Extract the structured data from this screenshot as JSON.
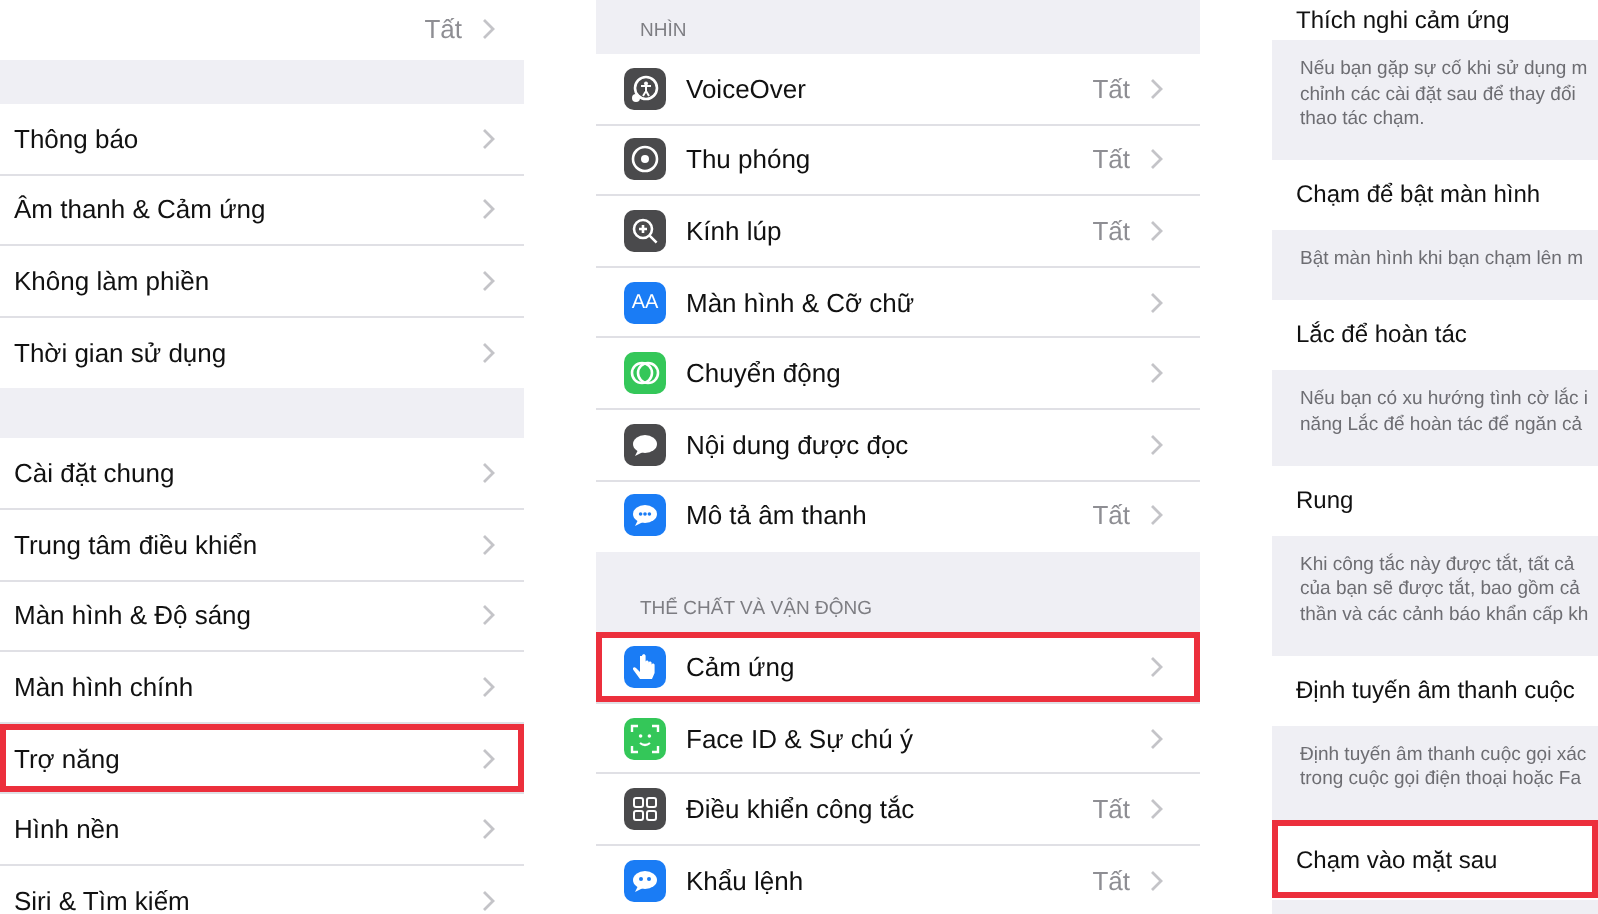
{
  "settings_list": {
    "groups": [
      [
        {
          "value": "Tất",
          "highlighted": false
        }
      ],
      [
        {
          "label": "Thông báo",
          "highlighted": false
        },
        {
          "label": "Âm thanh & Cảm ứng",
          "highlighted": false
        },
        {
          "label": "Không làm phiền",
          "highlighted": false
        },
        {
          "label": "Thời gian sử dụng",
          "highlighted": false
        }
      ],
      [
        {
          "label": "Cài đặt chung",
          "highlighted": false
        },
        {
          "label": "Trung tâm điều khiển",
          "highlighted": false
        },
        {
          "label": "Màn hình & Độ sáng",
          "highlighted": false
        },
        {
          "label": "Màn hình chính",
          "highlighted": false
        },
        {
          "label": "Trợ năng",
          "highlighted": true
        },
        {
          "label": "Hình nền",
          "highlighted": false
        },
        {
          "label": "Siri & Tìm kiếm",
          "highlighted": false
        }
      ]
    ]
  },
  "accessibility_list": {
    "sections": [
      {
        "header": "NHÌN",
        "rows": [
          {
            "label": "VoiceOver",
            "value": "Tất",
            "color": "#4a4a4c",
            "highlighted": false
          },
          {
            "label": "Thu phóng",
            "value": "Tất",
            "color": "#4a4a4c",
            "highlighted": false
          },
          {
            "label": "Kính lúp",
            "value": "Tất",
            "color": "#4a4a4c",
            "highlighted": false
          },
          {
            "label": "Màn hình & Cỡ chữ",
            "icon_text": "AA",
            "color": "#1a7cf5",
            "highlighted": false
          },
          {
            "label": "Chuyển động",
            "color": "#34c759",
            "highlighted": false
          },
          {
            "label": "Nội dung được đọc",
            "color": "#4a4a4c",
            "highlighted": false
          },
          {
            "label": "Mô tả âm thanh",
            "value": "Tất",
            "color": "#1a7cf5",
            "highlighted": false
          }
        ]
      },
      {
        "header": "THỂ CHẤT VÀ VẬN ĐỘNG",
        "rows": [
          {
            "label": "Cảm ứng",
            "color": "#1a7cf5",
            "highlighted": true
          },
          {
            "label": "Face ID & Sự chú ý",
            "color": "#34c759",
            "highlighted": false
          },
          {
            "label": "Điều khiển công tắc",
            "value": "Tất",
            "color": "#4a4a4c",
            "highlighted": false
          },
          {
            "label": "Khẩu lệnh",
            "value": "Tất",
            "color": "#1a7cf5",
            "highlighted": false
          }
        ]
      }
    ]
  },
  "touch_settings": {
    "items": [
      {
        "kind": "title",
        "label": "Thích nghi cảm ứng",
        "highlighted": false
      },
      {
        "kind": "note",
        "lines": [
          "Nếu bạn gặp sự cố khi sử dụng m",
          "chỉnh các cài đặt sau để thay đổi",
          "thao tác chạm."
        ]
      },
      {
        "kind": "title",
        "label": "Chạm để bật màn hình",
        "highlighted": false
      },
      {
        "kind": "note",
        "lines": [
          "Bật màn hình khi bạn chạm lên m"
        ]
      },
      {
        "kind": "title",
        "label": "Lắc để hoàn tác",
        "highlighted": false
      },
      {
        "kind": "note",
        "lines": [
          "Nếu bạn có xu hướng tình cờ lắc i",
          "năng Lắc để hoàn tác để ngăn cả"
        ]
      },
      {
        "kind": "title",
        "label": "Rung",
        "highlighted": false
      },
      {
        "kind": "note",
        "lines": [
          "Khi công tắc này được tắt, tất cả",
          "của bạn sẽ được tắt, bao gồm cả",
          "thần và các cảnh báo khẩn cấp kh"
        ]
      },
      {
        "kind": "title",
        "label": "Định tuyến âm thanh cuộc",
        "highlighted": false
      },
      {
        "kind": "note",
        "lines": [
          "Định tuyến âm thanh cuộc gọi xác",
          "trong cuộc gọi điện thoại hoặc Fa"
        ]
      },
      {
        "kind": "title",
        "label": "Chạm vào mặt sau",
        "highlighted": true
      }
    ]
  }
}
